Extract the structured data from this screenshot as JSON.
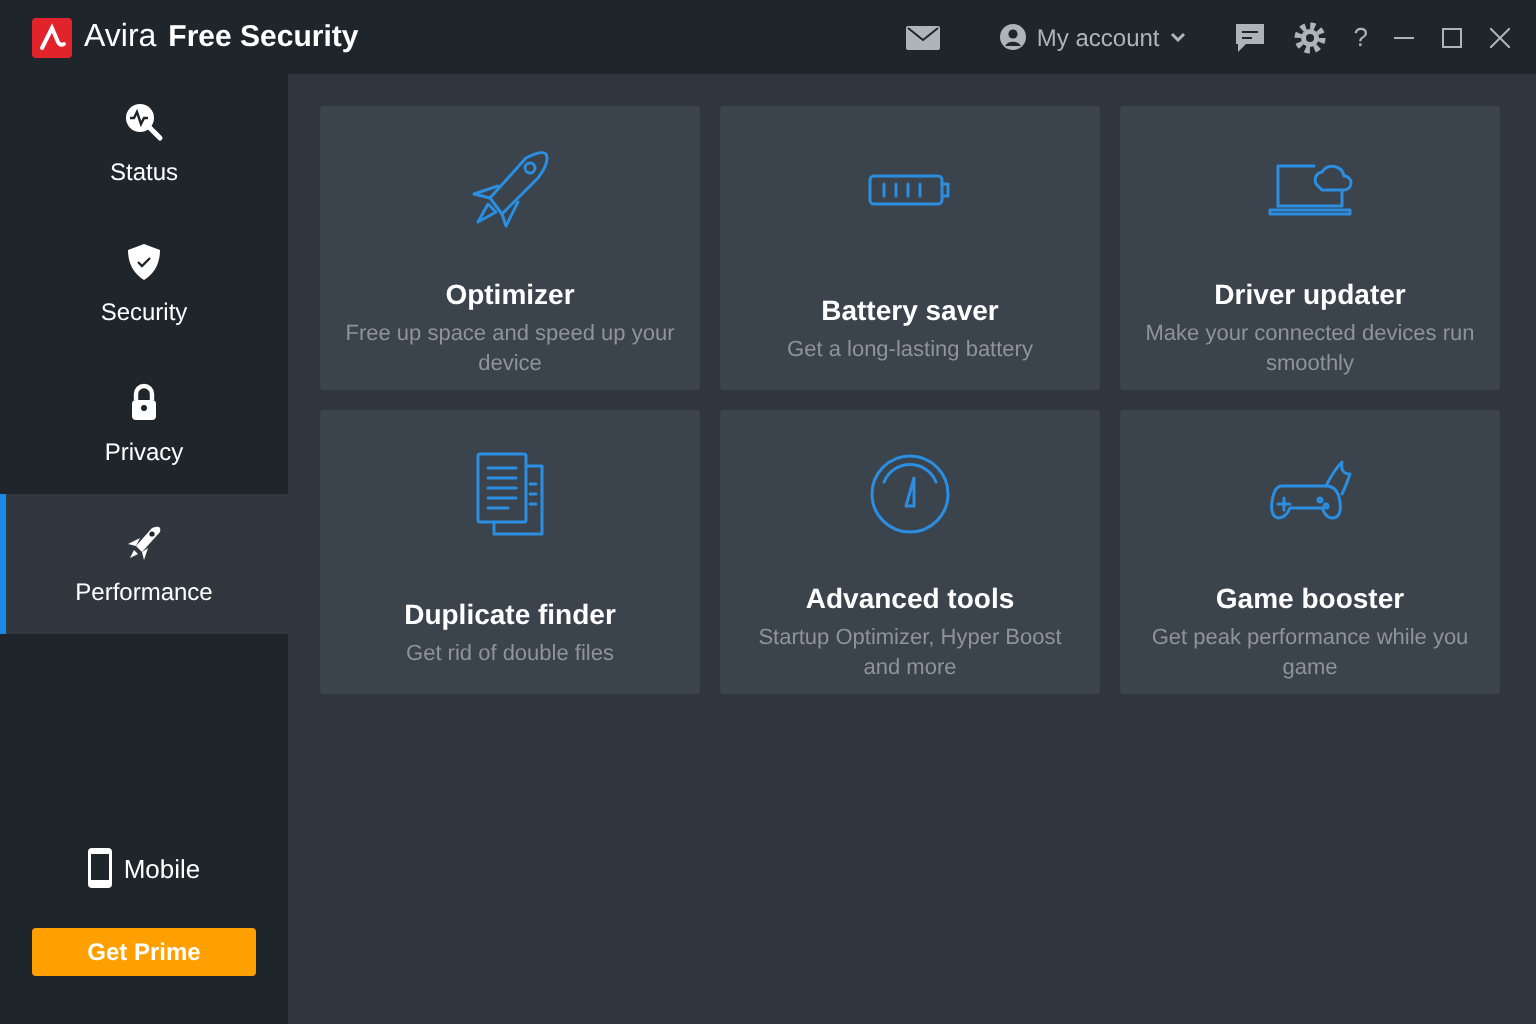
{
  "window": {
    "brand": "Avira",
    "title": "Free Security",
    "account": "My account",
    "help": "?"
  },
  "sidebar": {
    "items": [
      {
        "kind": "status",
        "label": "Status",
        "selected": false
      },
      {
        "kind": "security",
        "label": "Security",
        "selected": false
      },
      {
        "kind": "privacy",
        "label": "Privacy",
        "selected": false
      },
      {
        "kind": "performance",
        "label": "Performance",
        "selected": true
      }
    ],
    "mobile": "Mobile",
    "prime_button": "Get Prime"
  },
  "cards": [
    {
      "kind": "rocket",
      "title": "Optimizer",
      "description": "Free up space and speed up your device"
    },
    {
      "kind": "battery",
      "title": "Battery saver",
      "description": "Get a long-lasting battery"
    },
    {
      "kind": "laptop",
      "title": "Driver updater",
      "description": "Make your connected devices run smoothly"
    },
    {
      "kind": "documents",
      "title": "Duplicate finder",
      "description": "Get rid of double files"
    },
    {
      "kind": "gauge",
      "title": "Advanced tools",
      "description": "Startup Optimizer, Hyper Boost and more"
    },
    {
      "kind": "gamepad",
      "title": "Game booster",
      "description": "Get peak performance while you game"
    }
  ]
}
